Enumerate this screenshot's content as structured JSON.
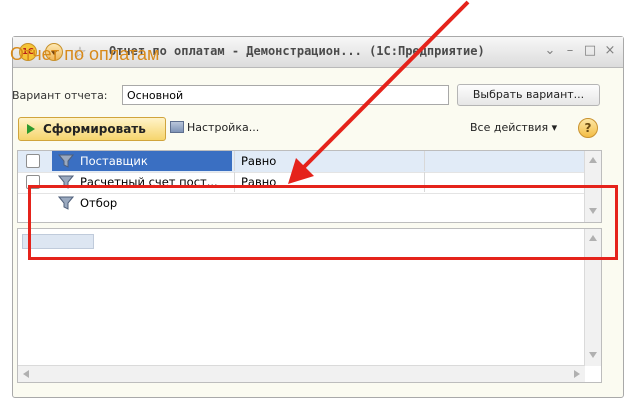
{
  "window": {
    "title": "Отчет по оплатам - Демонстрацион... (1С:Предприятие)",
    "logo_text": "1С",
    "controls": [
      "⌄",
      "–",
      "□",
      "×"
    ]
  },
  "form": {
    "title": "Отчет по оплатам",
    "variant_label": "Вариант отчета:",
    "variant_value": "Основной",
    "choose_variant": "Выбрать вариант..."
  },
  "toolbar": {
    "generate": "Сформировать",
    "settings": "Настройка...",
    "all_actions": "Все действия ▾",
    "help": "?"
  },
  "filters": [
    {
      "name": "Поставщик",
      "condition": "Равно",
      "has_checkbox": true,
      "selected": true
    },
    {
      "name": "Расчетный счет пост...",
      "condition": "Равно",
      "has_checkbox": true,
      "selected": false
    },
    {
      "name": "Отбор",
      "condition": "",
      "has_checkbox": false,
      "selected": false
    }
  ],
  "icons": {
    "funnel": "funnel-icon",
    "play": "play-icon",
    "settings": "settings-icon"
  },
  "colors": {
    "highlight_box": "#e5231b",
    "title_accent": "#d88a1a",
    "selection": "#3a6fc2"
  }
}
